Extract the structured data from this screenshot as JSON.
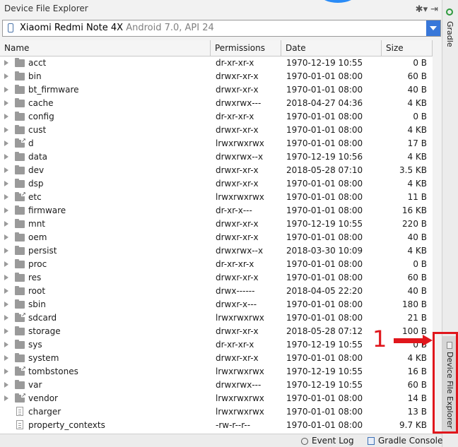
{
  "panel": {
    "title": "Device File Explorer",
    "tools": {
      "settings_glyph": "✱▾",
      "pin_glyph": "⇥"
    }
  },
  "device": {
    "name": "Xiaomi Redmi Note 4X",
    "meta": "Android 7.0, API 24"
  },
  "columns": {
    "name": "Name",
    "permissions": "Permissions",
    "date": "Date",
    "size": "Size"
  },
  "files": [
    {
      "name": "acct",
      "permissions": "dr-xr-xr-x",
      "date": "1970-12-19 10:55",
      "size": "0 B",
      "kind": "folder"
    },
    {
      "name": "bin",
      "permissions": "drwxr-xr-x",
      "date": "1970-01-01 08:00",
      "size": "60 B",
      "kind": "folder"
    },
    {
      "name": "bt_firmware",
      "permissions": "drwxr-xr-x",
      "date": "1970-01-01 08:00",
      "size": "40 B",
      "kind": "folder"
    },
    {
      "name": "cache",
      "permissions": "drwxrwx---",
      "date": "2018-04-27 04:36",
      "size": "4 KB",
      "kind": "folder"
    },
    {
      "name": "config",
      "permissions": "dr-xr-xr-x",
      "date": "1970-01-01 08:00",
      "size": "0 B",
      "kind": "folder"
    },
    {
      "name": "cust",
      "permissions": "drwxr-xr-x",
      "date": "1970-01-01 08:00",
      "size": "4 KB",
      "kind": "folder"
    },
    {
      "name": "d",
      "permissions": "lrwxrwxrwx",
      "date": "1970-01-01 08:00",
      "size": "17 B",
      "kind": "link"
    },
    {
      "name": "data",
      "permissions": "drwxrwx--x",
      "date": "1970-12-19 10:56",
      "size": "4 KB",
      "kind": "folder"
    },
    {
      "name": "dev",
      "permissions": "drwxr-xr-x",
      "date": "2018-05-28 07:10",
      "size": "3.5 KB",
      "kind": "folder"
    },
    {
      "name": "dsp",
      "permissions": "drwxr-xr-x",
      "date": "1970-01-01 08:00",
      "size": "4 KB",
      "kind": "folder"
    },
    {
      "name": "etc",
      "permissions": "lrwxrwxrwx",
      "date": "1970-01-01 08:00",
      "size": "11 B",
      "kind": "link"
    },
    {
      "name": "firmware",
      "permissions": "dr-xr-x---",
      "date": "1970-01-01 08:00",
      "size": "16 KB",
      "kind": "folder"
    },
    {
      "name": "mnt",
      "permissions": "drwxr-xr-x",
      "date": "1970-12-19 10:55",
      "size": "220 B",
      "kind": "folder"
    },
    {
      "name": "oem",
      "permissions": "drwxr-xr-x",
      "date": "1970-01-01 08:00",
      "size": "40 B",
      "kind": "folder"
    },
    {
      "name": "persist",
      "permissions": "drwxrwx--x",
      "date": "2018-03-30 10:09",
      "size": "4 KB",
      "kind": "folder"
    },
    {
      "name": "proc",
      "permissions": "dr-xr-xr-x",
      "date": "1970-01-01 08:00",
      "size": "0 B",
      "kind": "folder"
    },
    {
      "name": "res",
      "permissions": "drwxr-xr-x",
      "date": "1970-01-01 08:00",
      "size": "60 B",
      "kind": "folder"
    },
    {
      "name": "root",
      "permissions": "drwx------",
      "date": "2018-04-05 22:20",
      "size": "40 B",
      "kind": "folder"
    },
    {
      "name": "sbin",
      "permissions": "drwxr-x---",
      "date": "1970-01-01 08:00",
      "size": "180 B",
      "kind": "folder"
    },
    {
      "name": "sdcard",
      "permissions": "lrwxrwxrwx",
      "date": "1970-01-01 08:00",
      "size": "21 B",
      "kind": "link"
    },
    {
      "name": "storage",
      "permissions": "drwxr-xr-x",
      "date": "2018-05-28 07:12",
      "size": "100 B",
      "kind": "folder"
    },
    {
      "name": "sys",
      "permissions": "dr-xr-xr-x",
      "date": "1970-12-19 10:55",
      "size": "0 B",
      "kind": "folder"
    },
    {
      "name": "system",
      "permissions": "drwxr-xr-x",
      "date": "1970-01-01 08:00",
      "size": "4 KB",
      "kind": "folder"
    },
    {
      "name": "tombstones",
      "permissions": "lrwxrwxrwx",
      "date": "1970-12-19 10:55",
      "size": "16 B",
      "kind": "link"
    },
    {
      "name": "var",
      "permissions": "drwxrwx---",
      "date": "1970-12-19 10:55",
      "size": "60 B",
      "kind": "folder"
    },
    {
      "name": "vendor",
      "permissions": "lrwxrwxrwx",
      "date": "1970-01-01 08:00",
      "size": "14 B",
      "kind": "link"
    },
    {
      "name": "charger",
      "permissions": "lrwxrwxrwx",
      "date": "1970-01-01 08:00",
      "size": "13 B",
      "kind": "file"
    },
    {
      "name": "property_contexts",
      "permissions": "-rw-r--r--",
      "date": "1970-01-01 08:00",
      "size": "9.7 KB",
      "kind": "file"
    }
  ],
  "sidebar": {
    "gradle": "Gradle",
    "device_file_explorer": "Device File Explorer"
  },
  "annotation": {
    "number": "1",
    "color": "#e0161c"
  },
  "status_bar": {
    "event_log": "Event Log",
    "gradle_console": "Gradle Console"
  },
  "colors": {
    "accent": "#3877d9",
    "folder": "#9a9a9a",
    "gradle": "#2e9a3e"
  }
}
